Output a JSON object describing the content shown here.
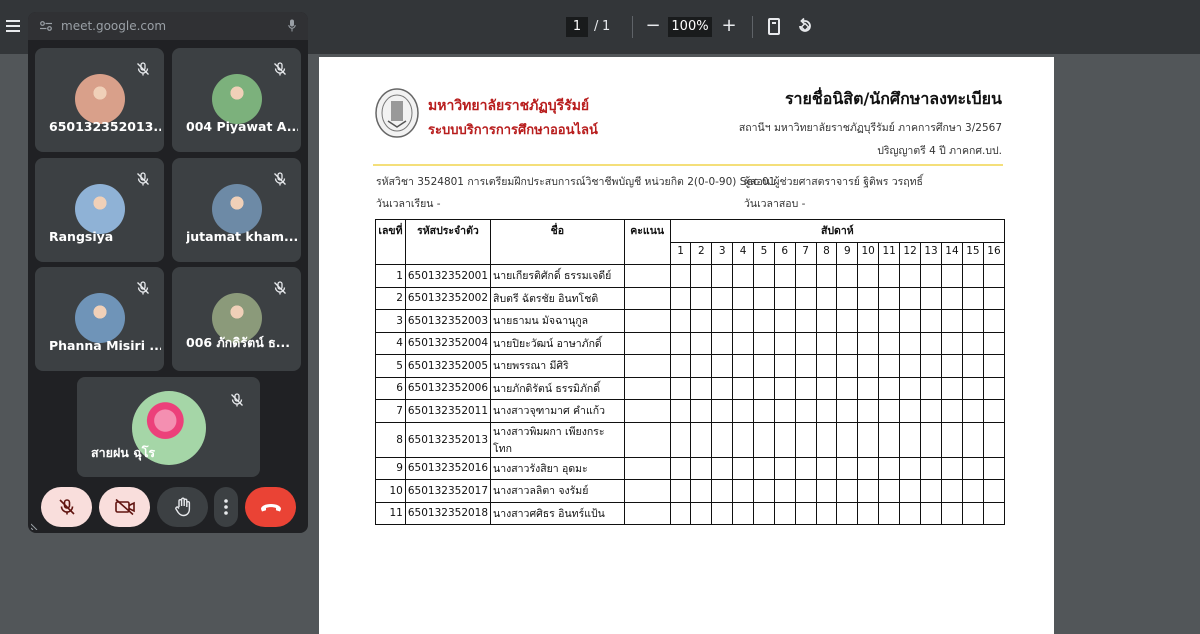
{
  "viewer": {
    "page_current": "1",
    "page_sep": "/",
    "page_total": "1",
    "zoom_minus": "−",
    "zoom": "100%",
    "zoom_plus": "+"
  },
  "meet": {
    "url": "meet.google.com",
    "participants": [
      {
        "name": "650132352013...",
        "avatar_color": "#d9a08a"
      },
      {
        "name": "004 Piyawat A...",
        "avatar_color": "#7cb17c"
      },
      {
        "name": "Rangsiya",
        "avatar_color": "#8fb2d6"
      },
      {
        "name": "jutamat kham...",
        "avatar_color": "#6d8aa6"
      },
      {
        "name": "Phanna Misiri ...",
        "avatar_color": "#6f94b8"
      },
      {
        "name": "006 ภักดิรัตน์ ธ...",
        "avatar_color": "#8b9a7a"
      }
    ],
    "host": {
      "name": "สายฝน ฉุโร"
    },
    "icons": [
      "mic-off-icon",
      "camera-off-icon",
      "raise-hand-icon",
      "more-vert-icon",
      "call-end-icon"
    ]
  },
  "document": {
    "uni_name": "มหาวิทยาลัยราชภัฏบุรีรัมย์",
    "uni_system": "ระบบบริการการศึกษาออนไลน์",
    "title": "รายชื่อนิสิต/นักศึกษาลงทะเบียน",
    "place": "สถานีฯ มหาวิทยาลัยราชภัฏบุรีรัมย์  ภาคการศึกษา 3/2567",
    "degree": "ปริญญาตรี 4  ปี ภาคกศ.บป.",
    "course": "รหัสวิชา  3524801  การเตรียมฝึกประสบการณ์วิชาชีพบัญชี  หน่วยกิต  2(0-0-90)  Sec  01",
    "instructor": "ผู้สอน ผู้ช่วยศาสตราจารย์ ฐิติพร วรฤทธิ์",
    "study_time": "วันเวลาเรียน -",
    "exam_time": "วันเวลาสอบ -",
    "headers": {
      "no": "เลขที่",
      "id": "รหัสประจำตัว",
      "name": "ชื่อ",
      "score": "คะแนน",
      "week": "สัปดาห์"
    },
    "weeks": [
      "1",
      "2",
      "3",
      "4",
      "5",
      "6",
      "7",
      "8",
      "9",
      "10",
      "11",
      "12",
      "13",
      "14",
      "15",
      "16"
    ],
    "students": [
      {
        "no": "1",
        "id": "650132352001",
        "name": "นายเกียรติศักดิ์  ธรรมเจดีย์"
      },
      {
        "no": "2",
        "id": "650132352002",
        "name": "สิบตรี ฉัตรชัย  อินทโชติ"
      },
      {
        "no": "3",
        "id": "650132352003",
        "name": "นายธามน  มัจฉานุกูล"
      },
      {
        "no": "4",
        "id": "650132352004",
        "name": "นายปิยะวัฒน์  อาษาภักดิ์"
      },
      {
        "no": "5",
        "id": "650132352005",
        "name": "นายพรรณา  มีศิริ"
      },
      {
        "no": "6",
        "id": "650132352006",
        "name": "นายภักดิรัตน์  ธรรมิภักดิ์"
      },
      {
        "no": "7",
        "id": "650132352011",
        "name": "นางสาวจุฑามาศ  คำแก้ว"
      },
      {
        "no": "8",
        "id": "650132352013",
        "name": "นางสาวพิมผกา  เพียงกระโทก"
      },
      {
        "no": "9",
        "id": "650132352016",
        "name": "นางสาวรังสิยา  อุดมะ"
      },
      {
        "no": "10",
        "id": "650132352017",
        "name": "นางสาวลลิตา  จงรัมย์"
      },
      {
        "no": "11",
        "id": "650132352018",
        "name": "นางสาวศศิธร  อินทร์แป้น"
      }
    ]
  }
}
